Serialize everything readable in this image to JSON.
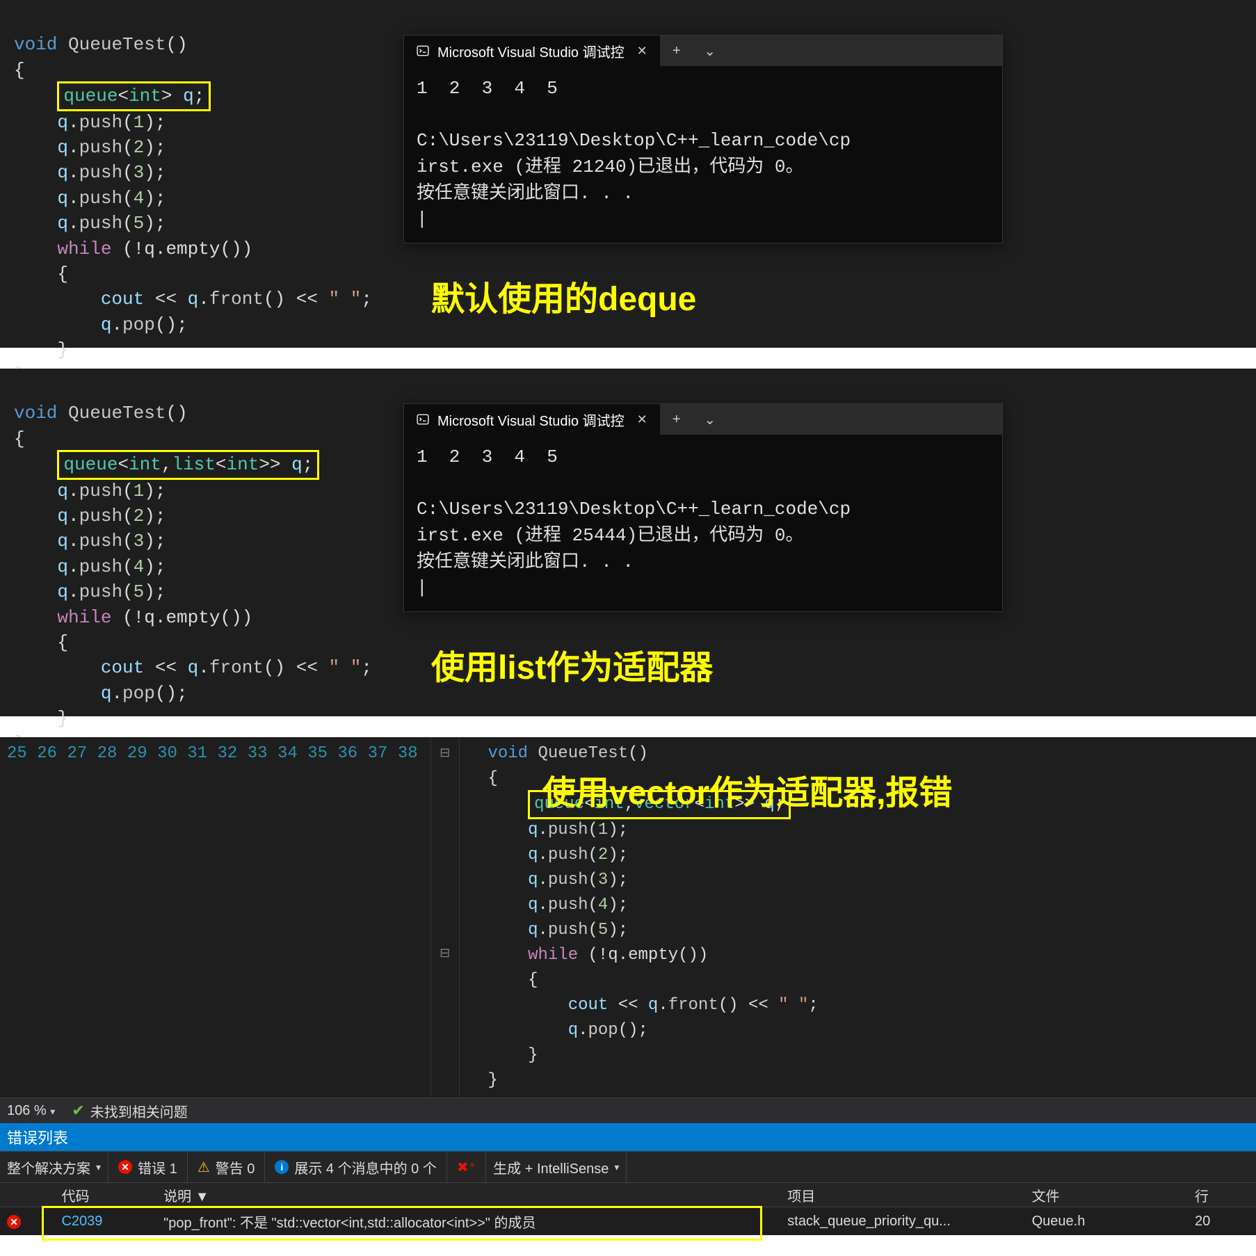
{
  "sections": [
    {
      "caption": "默认使用的deque",
      "highlight": "queue<int> q;",
      "terminal": {
        "tab_title": "Microsoft Visual Studio 调试控",
        "output_line": "1  2  3  4  5",
        "path_line": "C:\\Users\\23119\\Desktop\\C++_learn_code\\cp",
        "exit_line": "irst.exe (进程 21240)已退出，代码为 0。",
        "close_line": "按任意键关闭此窗口. . ."
      }
    },
    {
      "caption": "使用list作为适配器",
      "highlight": "queue<int,list<int>> q;",
      "terminal": {
        "tab_title": "Microsoft Visual Studio 调试控",
        "output_line": "1  2  3  4  5",
        "path_line": "C:\\Users\\23119\\Desktop\\C++_learn_code\\cp",
        "exit_line": "irst.exe (进程 25444)已退出，代码为 0。",
        "close_line": "按任意键关闭此窗口. . ."
      }
    },
    {
      "caption": "使用vector作为适配器,报错",
      "highlight": "queue<int,vector<int>> q;",
      "line_numbers": [
        "25",
        "26",
        "27",
        "28",
        "29",
        "30",
        "31",
        "32",
        "33",
        "34",
        "35",
        "36",
        "37",
        "38"
      ],
      "zoom": "106 %",
      "status_text": "未找到相关问题",
      "error_panel_title": "错误列表",
      "filters": {
        "solution": "整个解决方案",
        "errors": "错误 1",
        "warnings": "警告 0",
        "messages": "展示 4 个消息中的 0 个",
        "build": "生成 + IntelliSense"
      },
      "table": {
        "headers": {
          "code": "代码",
          "desc": "说明 ▼",
          "proj": "项目",
          "file": "文件",
          "line": "行"
        },
        "row": {
          "code": "C2039",
          "desc": "\"pop_front\": 不是 \"std::vector<int,std::allocator<int>>\" 的成员",
          "proj": "stack_queue_priority_qu...",
          "file": "Queue.h",
          "line": "20"
        }
      }
    }
  ],
  "code": {
    "fn_sig_void": "void",
    "fn_sig_name": "QueueTest",
    "push1": "q.push(1);",
    "push2": "q.push(2);",
    "push3": "q.push(3);",
    "push4": "q.push(4);",
    "push5": "q.push(5);",
    "while_kw": "while",
    "while_cond": "(!q.empty())",
    "cout_line_a": "cout << q.front() << ",
    "cout_line_str": "\" \"",
    "pop_line": "q.pop();"
  }
}
